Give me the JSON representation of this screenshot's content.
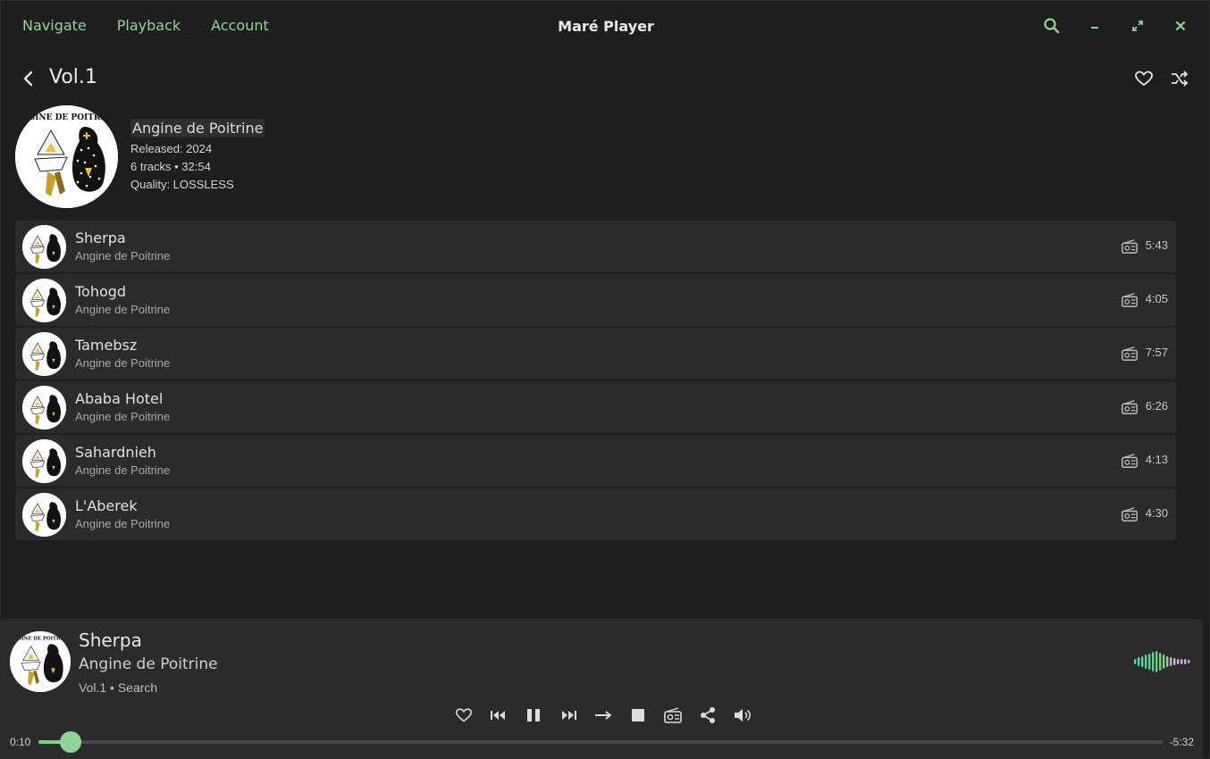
{
  "app": {
    "title": "Maré Player",
    "menu": [
      "Navigate",
      "Playback",
      "Account"
    ],
    "accent": "#8fd49a"
  },
  "album": {
    "title": "Vol.1",
    "artist": "Angine de Poitrine",
    "released": "Released: 2024",
    "summary": "6 tracks • 32:54",
    "quality": "Quality: LOSSLESS",
    "cover_text": "ANGINE DE POITRINE"
  },
  "tracks": [
    {
      "name": "Sherpa",
      "artist": "Angine de Poitrine",
      "duration": "5:43"
    },
    {
      "name": "Tohogd",
      "artist": "Angine de Poitrine",
      "duration": "4:05"
    },
    {
      "name": "Tamebsz",
      "artist": "Angine de Poitrine",
      "duration": "7:57"
    },
    {
      "name": "Ababa Hotel",
      "artist": "Angine de Poitrine",
      "duration": "6:26"
    },
    {
      "name": "Sahardnieh",
      "artist": "Angine de Poitrine",
      "duration": "4:13"
    },
    {
      "name": "L'Aberek",
      "artist": "Angine de Poitrine",
      "duration": "4:30"
    }
  ],
  "now_playing": {
    "title": "Sherpa",
    "artist": "Angine de Poitrine",
    "context": "Vol.1 • Search",
    "elapsed": "0:10",
    "remaining": "-5:32",
    "progress": 0.029
  },
  "icons": {
    "window": [
      "search-icon",
      "minimize-icon",
      "maximize-icon",
      "close-icon"
    ],
    "header": [
      "heart-icon",
      "shuffle-icon"
    ],
    "controls": [
      "heart-icon",
      "previous-icon",
      "pause-icon",
      "next-icon",
      "repeat-icon",
      "stop-icon",
      "radio-icon",
      "share-icon",
      "volume-icon"
    ]
  }
}
